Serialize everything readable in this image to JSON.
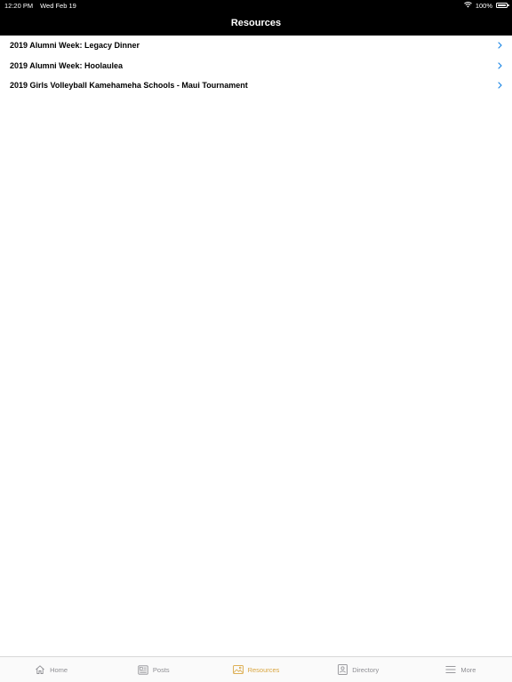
{
  "status_bar": {
    "time": "12:20 PM",
    "date": "Wed Feb 19",
    "battery": "100%",
    "battery_level": 1.0
  },
  "nav": {
    "title": "Resources"
  },
  "resources": [
    {
      "label": "2019 Alumni Week: Legacy Dinner"
    },
    {
      "label": "2019 Alumni Week: Hoolaulea"
    },
    {
      "label": "2019 Girls Volleyball Kamehameha Schools - Maui Tournament"
    }
  ],
  "tabs": [
    {
      "label": "Home",
      "icon": "home-icon"
    },
    {
      "label": "Posts",
      "icon": "posts-icon"
    },
    {
      "label": "Resources",
      "icon": "image-icon",
      "active": true
    },
    {
      "label": "Directory",
      "icon": "contact-card-icon"
    },
    {
      "label": "More",
      "icon": "menu-icon"
    }
  ],
  "colors": {
    "bar_background": "#000000",
    "accent": "#d9a53f",
    "chevron": "#1e88e5",
    "inactive_tab": "#8e8e93"
  }
}
